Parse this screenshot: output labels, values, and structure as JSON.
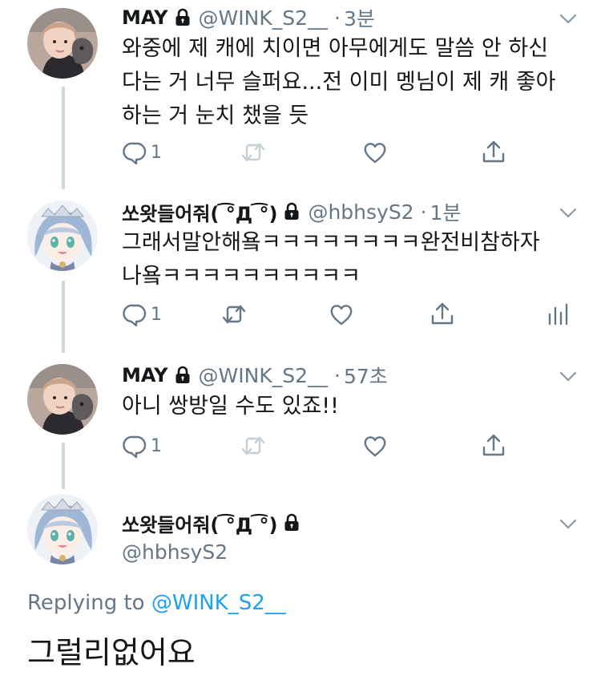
{
  "tweets": [
    {
      "name": "MAY",
      "handle": "@WINK_S2__",
      "time": "3분",
      "text_lines": [
        "와중에 제 캐에 치이면 아무에게도 말씀 안 하신",
        "다는 거 너무 슬퍼요...전 이미 멩님이 제 캐 좋아",
        "하는 거 눈치 챘을 듯"
      ],
      "reply_count": "1",
      "avatar": "boy-with-cat-avatar"
    },
    {
      "name": "쏘왓들어줘( ͡°Д ͡°)",
      "handle": "@hbhsyS2",
      "time": "1분",
      "text_lines": [
        "그래서말안해욬ㅋㅋㅋㅋㅋㅋㅋㅋ완전비참하자",
        "나욬ㅋㅋㅋㅋㅋㅋㅋㅋㅋㅋ"
      ],
      "reply_count": "1",
      "avatar": "anime-girl-avatar"
    },
    {
      "name": "MAY",
      "handle": "@WINK_S2__",
      "time": "57초",
      "text_lines": [
        "아니 쌍방일 수도 있죠!!"
      ],
      "reply_count": "1",
      "avatar": "boy-with-cat-avatar"
    }
  ],
  "focused": {
    "name": "쏘왓들어줘( ͡°Д ͡°)",
    "handle": "@hbhsyS2",
    "replying_prefix": "Replying to",
    "replying_to": "@WINK_S2__",
    "text": "그럴리없어요",
    "avatar": "anime-girl-avatar"
  },
  "separator": "·",
  "colors": {
    "text": "#14171a",
    "secondary": "#657786",
    "link": "#1da1f2",
    "thread_line": "#ccd6dd"
  }
}
